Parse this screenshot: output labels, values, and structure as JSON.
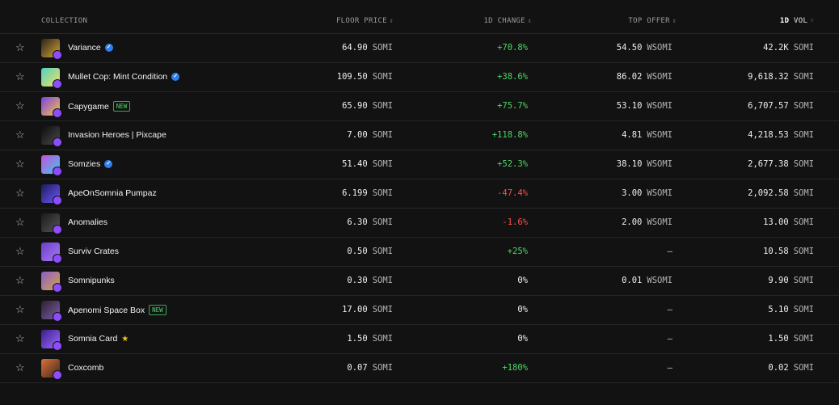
{
  "header": {
    "collection": "COLLECTION",
    "floor_price": "FLOOR PRICE",
    "change": "1D CHANGE",
    "top_offer": "TOP OFFER",
    "vol_prefix": "1D",
    "vol_label": "VOL",
    "sort_icon": "⇕",
    "sort_active_icon": "˅"
  },
  "rows": [
    {
      "name": "Variance",
      "verified": true,
      "badge": "",
      "floor": "64.90",
      "floor_unit": "SOMI",
      "change": "+70.8%",
      "change_type": "pos",
      "offer": "54.50",
      "offer_unit": "WSOMI",
      "vol": "42.2K",
      "vol_unit": "SOMI",
      "thumb_colors": [
        "#2a2416",
        "#d4a23a"
      ]
    },
    {
      "name": "Mullet Cop: Mint Condition",
      "verified": true,
      "badge": "",
      "floor": "109.50",
      "floor_unit": "SOMI",
      "change": "+38.6%",
      "change_type": "pos",
      "offer": "86.02",
      "offer_unit": "WSOMI",
      "vol": "9,618.32",
      "vol_unit": "SOMI",
      "thumb_colors": [
        "#4fd1c5",
        "#f6e05e"
      ]
    },
    {
      "name": "Capygame",
      "verified": false,
      "badge": "NEW",
      "floor": "65.90",
      "floor_unit": "SOMI",
      "change": "+75.7%",
      "change_type": "pos",
      "offer": "53.10",
      "offer_unit": "WSOMI",
      "vol": "6,707.57",
      "vol_unit": "SOMI",
      "thumb_colors": [
        "#7b3fe4",
        "#f6c744"
      ]
    },
    {
      "name": "Invasion Heroes | Pixcape",
      "verified": false,
      "badge": "",
      "floor": "7.00",
      "floor_unit": "SOMI",
      "change": "+118.8%",
      "change_type": "pos",
      "offer": "4.81",
      "offer_unit": "WSOMI",
      "vol": "4,218.53",
      "vol_unit": "SOMI",
      "thumb_colors": [
        "#0d0d0d",
        "#4a4a4a"
      ]
    },
    {
      "name": "Somzies",
      "verified": true,
      "badge": "",
      "floor": "51.40",
      "floor_unit": "SOMI",
      "change": "+52.3%",
      "change_type": "pos",
      "offer": "38.10",
      "offer_unit": "WSOMI",
      "vol": "2,677.38",
      "vol_unit": "SOMI",
      "thumb_colors": [
        "#c84fd8",
        "#3ec7f0"
      ]
    },
    {
      "name": "ApeOnSomnia Pumpaz",
      "verified": false,
      "badge": "",
      "floor": "6.199",
      "floor_unit": "SOMI",
      "change": "-47.4%",
      "change_type": "neg",
      "offer": "3.00",
      "offer_unit": "WSOMI",
      "vol": "2,092.58",
      "vol_unit": "SOMI",
      "thumb_colors": [
        "#1e1a5e",
        "#6a5af9"
      ]
    },
    {
      "name": "Anomalies",
      "verified": false,
      "badge": "",
      "floor": "6.30",
      "floor_unit": "SOMI",
      "change": "-1.6%",
      "change_type": "neg",
      "offer": "2.00",
      "offer_unit": "WSOMI",
      "vol": "13.00",
      "vol_unit": "SOMI",
      "thumb_colors": [
        "#1a1a1a",
        "#555555"
      ]
    },
    {
      "name": "Surviv Crates",
      "verified": false,
      "badge": "",
      "floor": "0.50",
      "floor_unit": "SOMI",
      "change": "+25%",
      "change_type": "pos",
      "offer": "–",
      "offer_unit": "",
      "vol": "10.58",
      "vol_unit": "SOMI",
      "thumb_colors": [
        "#6b3fc9",
        "#a77bf2"
      ]
    },
    {
      "name": "Somnipunks",
      "verified": false,
      "badge": "",
      "floor": "0.30",
      "floor_unit": "SOMI",
      "change": "0%",
      "change_type": "neu",
      "offer": "0.01",
      "offer_unit": "WSOMI",
      "vol": "9.90",
      "vol_unit": "SOMI",
      "thumb_colors": [
        "#8a5cc9",
        "#d6a64a"
      ]
    },
    {
      "name": "Apenomi Space Box",
      "verified": false,
      "badge": "NEW",
      "floor": "17.00",
      "floor_unit": "SOMI",
      "change": "0%",
      "change_type": "neu",
      "offer": "–",
      "offer_unit": "",
      "vol": "5.10",
      "vol_unit": "SOMI",
      "thumb_colors": [
        "#2b2030",
        "#7d5fa8"
      ]
    },
    {
      "name": "Somnia Card",
      "verified": false,
      "badge": "",
      "gold_star": true,
      "floor": "1.50",
      "floor_unit": "SOMI",
      "change": "0%",
      "change_type": "neu",
      "offer": "–",
      "offer_unit": "",
      "vol": "1.50",
      "vol_unit": "SOMI",
      "thumb_colors": [
        "#3a1f8a",
        "#9b6bff"
      ]
    },
    {
      "name": "Coxcomb",
      "verified": false,
      "badge": "",
      "floor": "0.07",
      "floor_unit": "SOMI",
      "change": "+180%",
      "change_type": "pos",
      "offer": "–",
      "offer_unit": "",
      "vol": "0.02",
      "vol_unit": "SOMI",
      "thumb_colors": [
        "#e0703a",
        "#3a2a1a"
      ]
    }
  ]
}
